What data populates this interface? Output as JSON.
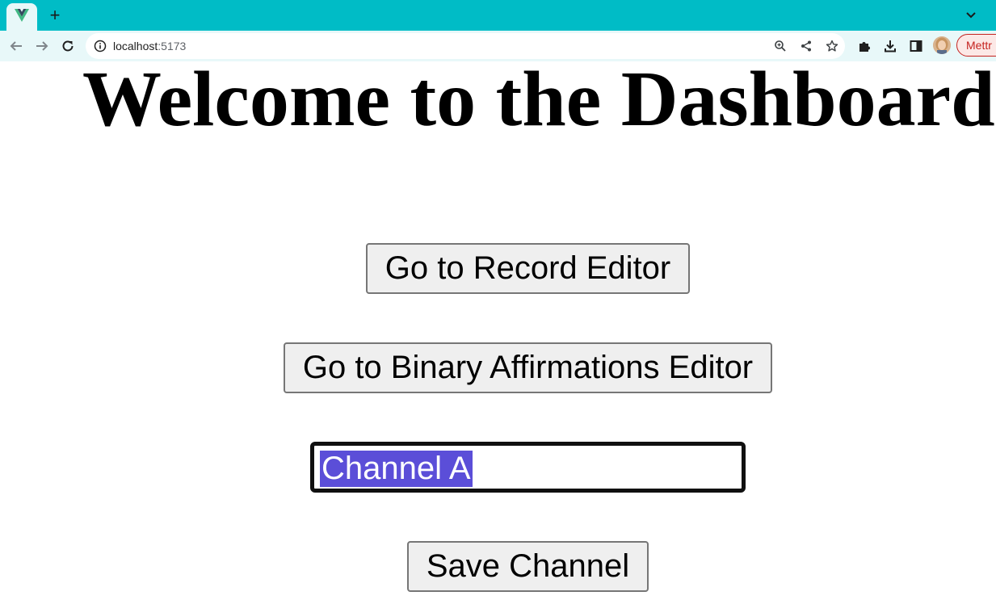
{
  "browser": {
    "tab_icon": "vue-logo-icon",
    "new_tab_label": "+",
    "url_host": "localhost",
    "url_port": ":5173",
    "profile_label": "Mettr",
    "accent_color": "#00bcc6"
  },
  "page": {
    "title": "Welcome to the Dashboard",
    "record_editor_button": "Go to Record Editor",
    "binary_editor_button": "Go to Binary Affirmations Editor",
    "channel_input_value": "Channel A",
    "save_channel_button": "Save Channel",
    "selection_color": "#5b4ed8"
  }
}
